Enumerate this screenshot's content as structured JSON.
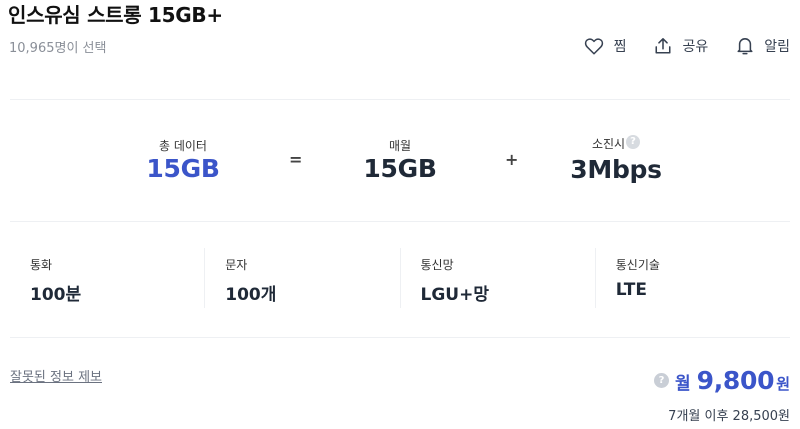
{
  "plan": {
    "name": "인스유심 스트롱 15GB+",
    "selection_count": "10,965명이 선택"
  },
  "actions": {
    "favorite_label": "찜",
    "share_label": "공유",
    "alert_label": "알림"
  },
  "data_summary": {
    "total_label": "총 데이터",
    "total_value": "15GB",
    "equals": "=",
    "monthly_label": "매월",
    "monthly_value": "15GB",
    "plus": "+",
    "exhausted_label": "소진시",
    "exhausted_value": "3Mbps",
    "help_glyph": "?"
  },
  "specs": [
    {
      "label": "통화",
      "value": "100분"
    },
    {
      "label": "문자",
      "value": "100개"
    },
    {
      "label": "통신망",
      "value": "LGU+망"
    },
    {
      "label": "통신기술",
      "value": "LTE"
    }
  ],
  "footer": {
    "report_link": "잘못된 정보 제보",
    "price_help_glyph": "?",
    "price_prefix": "월",
    "price_amount": "9,800",
    "price_suffix": "원",
    "price_after": "7개월 이후 28,500원"
  },
  "colors": {
    "accent": "#3b55c9",
    "divider": "#eef0f3",
    "muted_text": "#8a8f98"
  },
  "icons": {
    "favorite": "heart-icon",
    "share": "share-icon",
    "alert": "bell-icon",
    "help": "question-circle-icon"
  }
}
